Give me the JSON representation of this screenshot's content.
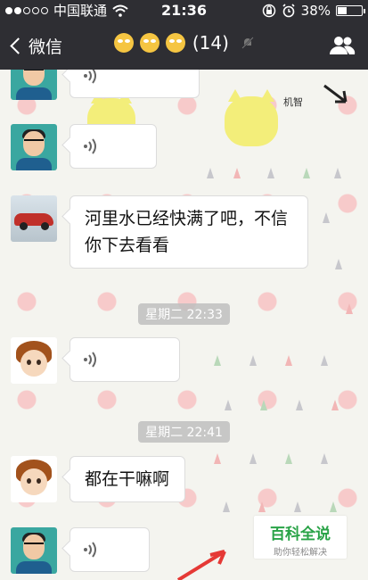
{
  "status_bar": {
    "carrier": "中国联通",
    "time": "21:36",
    "battery": "38%",
    "battery_level": 0.38,
    "icons": [
      "signal-dots-icon",
      "wifi-icon",
      "lock-rotation-icon",
      "alarm-icon",
      "battery-icon"
    ]
  },
  "nav": {
    "back_label": "微信",
    "title_count": "(14)",
    "icons": [
      "rolling-eyes-emoji-icon",
      "mute-bell-icon",
      "group-members-icon"
    ]
  },
  "messages": [
    {
      "type": "voice",
      "avatar": "man-avatar"
    },
    {
      "type": "voice",
      "avatar": "man-avatar"
    },
    {
      "type": "text",
      "avatar": "red-car-avatar",
      "text": "河里水已经快满了吧，不信你下去看看"
    },
    {
      "type": "timestamp",
      "text": "星期二 22:33"
    },
    {
      "type": "voice",
      "avatar": "boy-avatar"
    },
    {
      "type": "timestamp",
      "text": "星期二 22:41"
    },
    {
      "type": "text",
      "avatar": "boy-avatar",
      "text": "都在干嘛啊"
    },
    {
      "type": "voice",
      "avatar": "man-avatar"
    }
  ],
  "wallpaper": {
    "sticker_text": "机智"
  },
  "watermark": {
    "title": "百科全说",
    "subtitle": "助你轻松解决"
  }
}
